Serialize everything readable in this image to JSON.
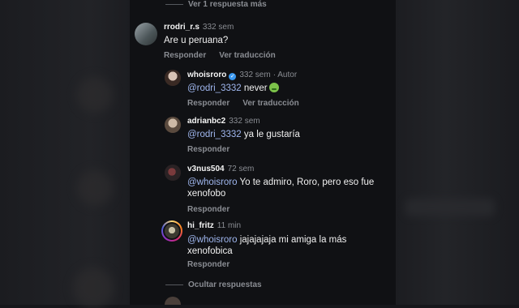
{
  "top_link": "Ver 1 respuesta más",
  "comments": [
    {
      "username": "rrodri_r.s",
      "time": "332 sem",
      "mention": "",
      "text": "Are u peruana?",
      "actions": [
        "Responder",
        "Ver traducción"
      ]
    },
    {
      "username": "whoisroro",
      "time": "332 sem",
      "author_label": "· Autor",
      "mention": "@rodri_3332",
      "text": " never",
      "actions": [
        "Responder",
        "Ver traducción"
      ]
    },
    {
      "username": "adrianbc2",
      "time": "332 sem",
      "mention": "@rodri_3332",
      "text": " ya le gustaría",
      "actions": [
        "Responder"
      ]
    },
    {
      "username": "v3nus504",
      "time": "72 sem",
      "mention": "@whoisroro",
      "text": " Yo te admiro, Roro, pero eso fue xenofobo",
      "actions": [
        "Responder"
      ]
    },
    {
      "username": "hi_fritz",
      "time": "11 min",
      "mention": "@whoisroro",
      "text": " jajajajaja mi amiga la más xenofobica",
      "actions": [
        "Responder"
      ]
    }
  ],
  "hide_link": "Ocultar respuestas",
  "icons": {
    "verified": "verified-badge-icon",
    "emoji": "nauseated-face-emoji-icon"
  },
  "colors": {
    "mention": "#9fb6ee",
    "muted": "#8a8d93",
    "verified": "#3897f0",
    "story_ring": "#d62976"
  }
}
